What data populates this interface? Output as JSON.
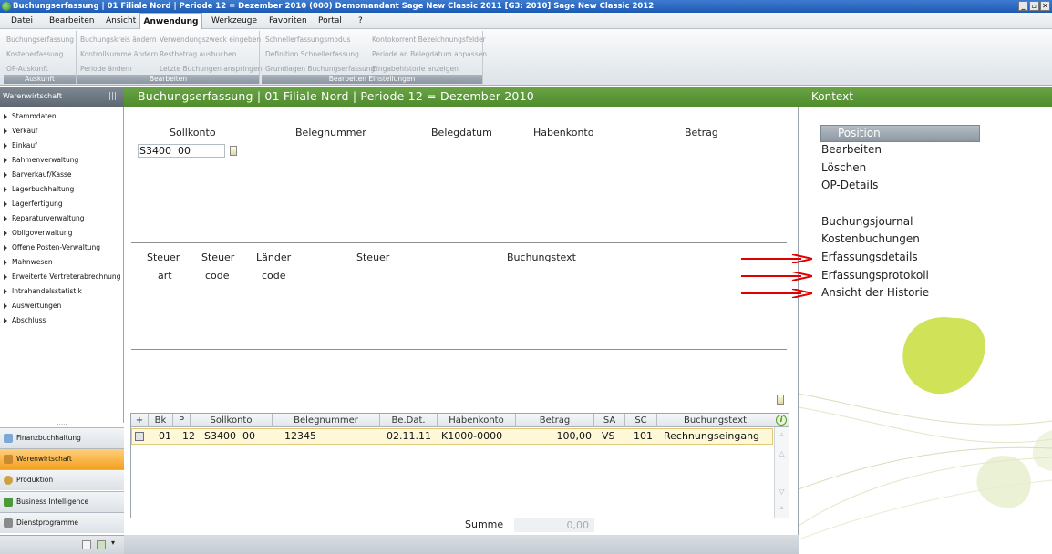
{
  "window": {
    "title": "Buchungserfassung | 01 Filiale Nord | Periode 12 = Dezember 2010 (000) Demomandant Sage New Classic 2011 [G3: 2010] Sage New Classic 2012",
    "controls": [
      "_",
      "▫",
      "✕"
    ]
  },
  "menu": [
    "Datei",
    "Bearbeiten",
    "Ansicht",
    "Anwendung",
    "Werkzeuge",
    "Favoriten",
    "Portal",
    "?"
  ],
  "ribbon": {
    "groups": [
      {
        "label": "Auskunft",
        "items": [
          "Buchungserfassung",
          "Kostenerfassung",
          "OP-Auskunft"
        ]
      },
      {
        "label": "Bearbeiten",
        "items": [
          "Buchungskreis ändern",
          "Kontrollsumme ändern",
          "Periode ändern",
          "Verwendungszweck eingeben",
          "Restbetrag ausbuchen",
          "Letzte Buchungen anspringen"
        ]
      },
      {
        "label": "Bearbeiten Einstellungen",
        "items": [
          "Schnellerfassungsmodus",
          "Definition Schnellerfassung",
          "Grundlagen Buchungserfassung",
          "Kontokorrent Bezeichnungsfelder",
          "Periode an Belegdatum anpassen",
          "Eingabehistorie anzeigen"
        ]
      }
    ]
  },
  "leftpanel": {
    "title": "Warenwirtschaft",
    "grip": "|||",
    "items": [
      "Stammdaten",
      "Verkauf",
      "Einkauf",
      "Rahmenverwaltung",
      "Barverkauf/Kasse",
      "Lagerbuchhaltung",
      "Lagerfertigung",
      "Reparaturverwaltung",
      "Obligoverwaltung",
      "Offene Posten-Verwaltung",
      "Mahnwesen",
      "Erweiterte Vertreterabrechnung",
      "Intrahandelsstatistik",
      "Auswertungen",
      "Abschluss"
    ],
    "splitter": ".....",
    "modules": [
      "Finanzbuchhaltung",
      "Warenwirtschaft",
      "Produktion",
      "Business Intelligence",
      "Dienstprogramme"
    ]
  },
  "main": {
    "title": "Buchungserfassung | 01 Filiale Nord | Periode 12 = Dezember 2010",
    "headers": [
      "Sollkonto",
      "Belegnummer",
      "Belegdatum",
      "Habenkonto",
      "Betrag"
    ],
    "sollkonto_value": "S3400  00",
    "sub_headers": {
      "steuer_art": [
        "Steuer",
        "art"
      ],
      "steuer_code": [
        "Steuer",
        "code"
      ],
      "laender_code": [
        "Länder",
        "code"
      ],
      "steuer": "Steuer",
      "buchungstext": "Buchungstext"
    }
  },
  "grid": {
    "columns": [
      "+",
      "Bk",
      "P",
      "Sollkonto",
      "Belegnummer",
      "Be.Dat.",
      "Habenkonto",
      "Betrag",
      "SA",
      "SC",
      "Buchungstext"
    ],
    "rows": [
      {
        "bk": "01",
        "p": "12",
        "sollkonto": "S3400  00",
        "belegnummer": "12345",
        "bedat": "02.11.11",
        "habenkonto": "K1000-0000",
        "betrag": "100,00",
        "sa": "VS",
        "sc": "101",
        "buchungstext": "Rechnungseingang"
      }
    ],
    "summe_label": "Summe",
    "summe_value": "0,00"
  },
  "kontext": {
    "title": "Kontext",
    "position_button": "Position",
    "links": [
      "Bearbeiten",
      "Löschen",
      "OP-Details",
      "Buchungsjournal",
      "Kostenbuchungen",
      "Erfassungsdetails",
      "Erfassungsprotokoll",
      "Ansicht der Historie"
    ]
  },
  "colors": {
    "header_green": "#5a9a36",
    "active_module": "#f4a020",
    "arrow_red": "#e00000",
    "leaf_green": "#c8dd3a"
  }
}
